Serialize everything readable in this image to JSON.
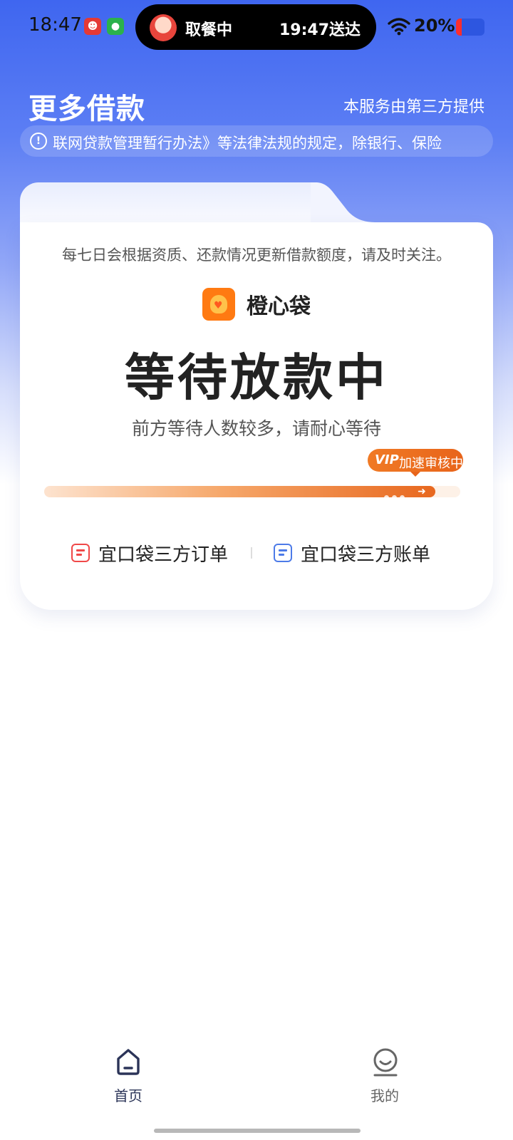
{
  "status_bar": {
    "time": "18:47",
    "island_status": "取餐中",
    "island_eta": "19:47送达",
    "battery_text": "20%",
    "icons": [
      "meituan-icon",
      "wechat-icon",
      "wifi-icon",
      "battery-icon"
    ]
  },
  "header": {
    "title": "更多借款",
    "provider_note": "本服务由第三方提供",
    "notice_text": "联网贷款管理暂行办法》等法律法规的规定，除银行、保险"
  },
  "card": {
    "hint": "每七日会根据资质、还款情况更新借款额度，请及时关注。",
    "brand_name": "橙心袋",
    "status_title": "等待放款中",
    "status_sub": "前方等待人数较多，请耐心等待",
    "vip_tag": "VIP",
    "vip_text": "加速审核中",
    "progress": 0.94,
    "links": {
      "orders": "宜口袋三方订单",
      "bills": "宜口袋三方账单"
    }
  },
  "nav": {
    "home_label": "首页",
    "mine_label": "我的"
  },
  "colors": {
    "primary_blue": "#3f66f0",
    "accent_orange": "#e8681f",
    "brand_orange": "#ff7a12"
  }
}
